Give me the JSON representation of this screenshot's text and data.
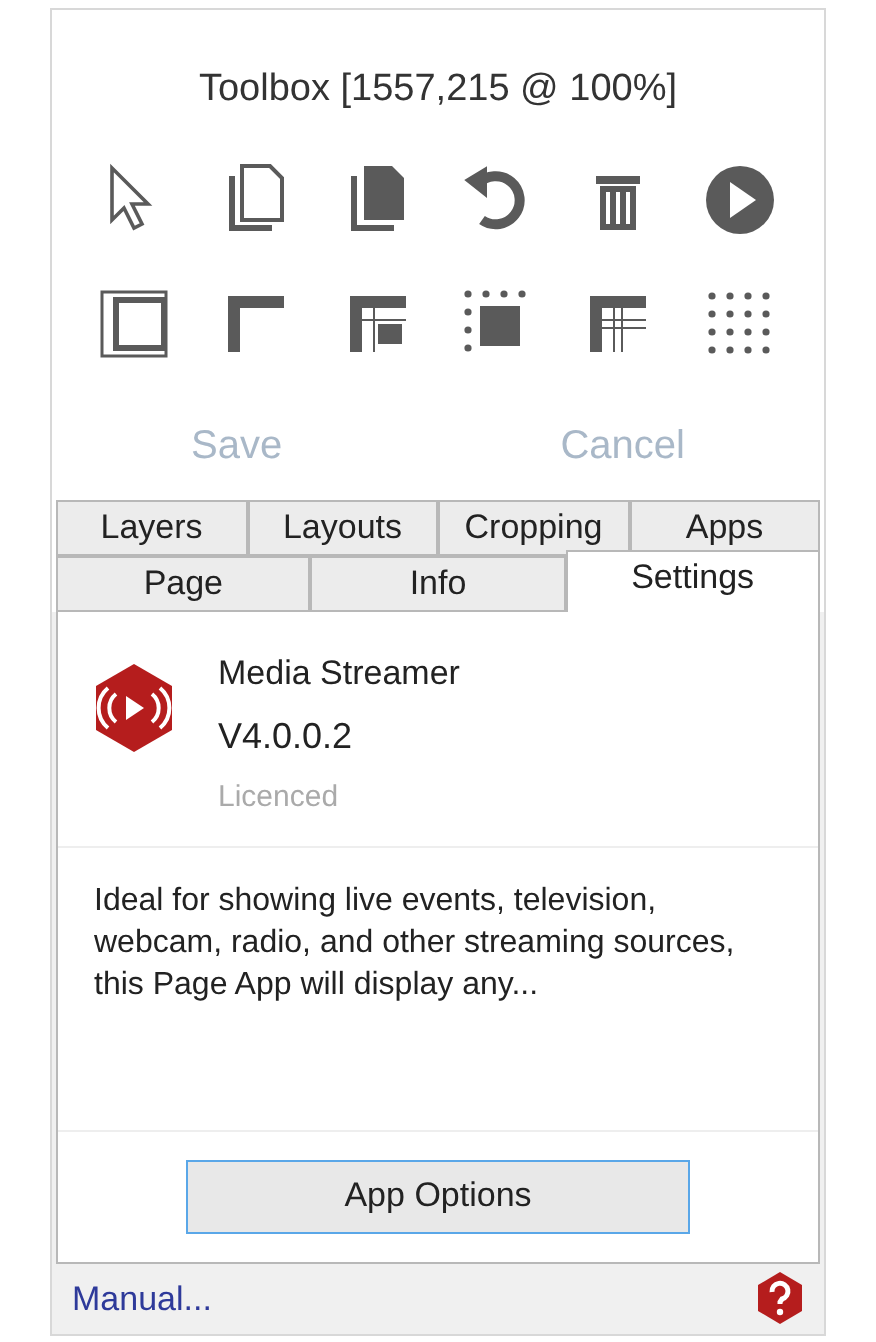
{
  "window": {
    "title": "Toolbox [1557,215 @ 100%]"
  },
  "actions": [
    {
      "label": "Save",
      "disabled": true
    },
    {
      "label": "Cancel",
      "disabled": true
    }
  ],
  "tab_rows": [
    [
      {
        "label": "Layers",
        "selected": false
      },
      {
        "label": "Layouts",
        "selected": false
      },
      {
        "label": "Cropping",
        "selected": false
      },
      {
        "label": "Apps",
        "selected": false
      }
    ],
    [
      {
        "label": "Page",
        "selected": false
      },
      {
        "label": "Info",
        "selected": false
      },
      {
        "label": "Settings",
        "selected": true
      }
    ]
  ],
  "app": {
    "name": "Media Streamer",
    "version": "V4.0.0.2",
    "license": "Licenced",
    "description": "Ideal for showing live events, television, webcam, radio, and other streaming sources, this Page App will display any...",
    "button": "App Options"
  },
  "footer": {
    "link": "Manual..."
  }
}
